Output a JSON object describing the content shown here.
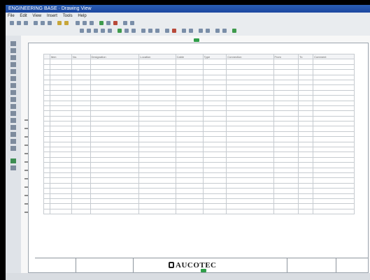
{
  "app": {
    "title": "ENGINEERING BASE · Drawing View"
  },
  "menu": {
    "items": [
      "File",
      "Edit",
      "View",
      "Insert",
      "Tools",
      "Help"
    ]
  },
  "logo": {
    "text": "AUCOTEC"
  },
  "colors": {
    "titlebar": "#1c46a0",
    "accent": "#2f9e49",
    "sheet_bg": "#ffffff",
    "frame": "#000000"
  },
  "table": {
    "columns": [
      "",
      "Item",
      "No.",
      "Designation",
      "Location",
      "Cable",
      "Type",
      "Connection",
      "From",
      "To",
      "Comment"
    ],
    "rows": [
      [
        "",
        "",
        "",
        "",
        "",
        "",
        "",
        "",
        "",
        "",
        ""
      ],
      [
        "",
        "",
        "",
        "",
        "",
        "",
        "",
        "",
        "",
        "",
        ""
      ],
      [
        "",
        "",
        "",
        "",
        "",
        "",
        "",
        "",
        "",
        "",
        ""
      ],
      [
        "",
        "",
        "",
        "",
        "",
        "",
        "",
        "",
        "",
        "",
        ""
      ],
      [
        "",
        "",
        "",
        "",
        "",
        "",
        "",
        "",
        "",
        "",
        ""
      ],
      [
        "",
        "",
        "",
        "",
        "",
        "",
        "",
        "",
        "",
        "",
        ""
      ],
      [
        "",
        "",
        "",
        "",
        "",
        "",
        "",
        "",
        "",
        "",
        ""
      ],
      [
        "",
        "",
        "",
        "",
        "",
        "",
        "",
        "",
        "",
        "",
        ""
      ],
      [
        "",
        "",
        "",
        "",
        "",
        "",
        "",
        "",
        "",
        "",
        ""
      ],
      [
        "",
        "",
        "",
        "",
        "",
        "",
        "",
        "",
        "",
        "",
        ""
      ],
      [
        "",
        "",
        "",
        "",
        "",
        "",
        "",
        "",
        "",
        "",
        ""
      ],
      [
        "",
        "",
        "",
        "",
        "",
        "",
        "",
        "",
        "",
        "",
        ""
      ],
      [
        "",
        "",
        "",
        "",
        "",
        "",
        "",
        "",
        "",
        "",
        ""
      ],
      [
        "",
        "",
        "",
        "",
        "",
        "",
        "",
        "",
        "",
        "",
        ""
      ],
      [
        "",
        "",
        "",
        "",
        "",
        "",
        "",
        "",
        "",
        "",
        ""
      ],
      [
        "",
        "",
        "",
        "",
        "",
        "",
        "",
        "",
        "",
        "",
        ""
      ],
      [
        "",
        "",
        "",
        "",
        "",
        "",
        "",
        "",
        "",
        "",
        ""
      ],
      [
        "",
        "",
        "",
        "",
        "",
        "",
        "",
        "",
        "",
        "",
        ""
      ],
      [
        "",
        "",
        "",
        "",
        "",
        "",
        "",
        "",
        "",
        "",
        ""
      ],
      [
        "",
        "",
        "",
        "",
        "",
        "",
        "",
        "",
        "",
        "",
        ""
      ],
      [
        "",
        "",
        "",
        "",
        "",
        "",
        "",
        "",
        "",
        "",
        ""
      ],
      [
        "",
        "",
        "",
        "",
        "",
        "",
        "",
        "",
        "",
        "",
        ""
      ],
      [
        "",
        "",
        "",
        "",
        "",
        "",
        "",
        "",
        "",
        "",
        ""
      ],
      [
        "",
        "",
        "",
        "",
        "",
        "",
        "",
        "",
        "",
        "",
        ""
      ],
      [
        "",
        "",
        "",
        "",
        "",
        "",
        "",
        "",
        "",
        "",
        ""
      ],
      [
        "",
        "",
        "",
        "",
        "",
        "",
        "",
        "",
        "",
        "",
        ""
      ],
      [
        "",
        "",
        "",
        "",
        "",
        "",
        "",
        "",
        "",
        "",
        ""
      ],
      [
        "",
        "",
        "",
        "",
        "",
        "",
        "",
        "",
        "",
        "",
        ""
      ],
      [
        "",
        "",
        "",
        "",
        "",
        "",
        "",
        "",
        "",
        "",
        ""
      ],
      [
        "",
        "",
        "",
        "",
        "",
        "",
        "",
        "",
        "",
        "",
        ""
      ]
    ]
  }
}
